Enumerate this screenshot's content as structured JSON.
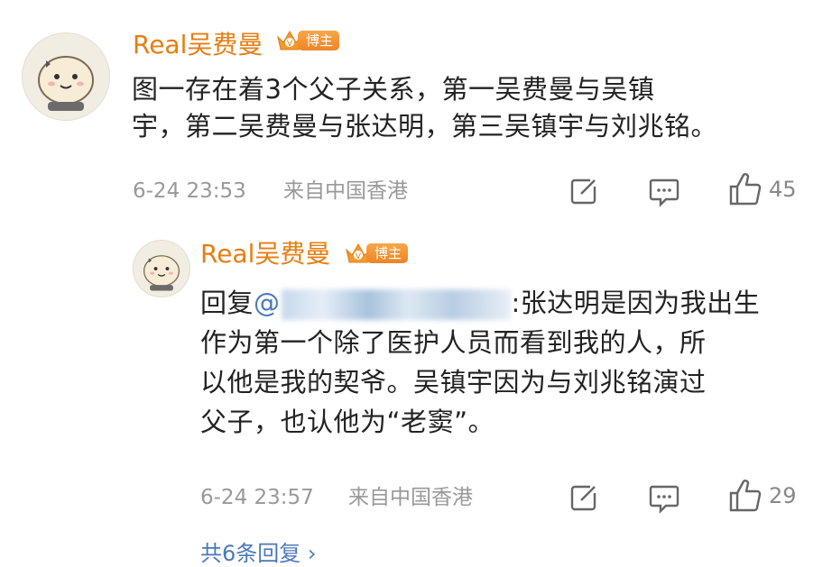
{
  "comment": {
    "username": "Real吴费曼",
    "badge_label": "博主",
    "text_line1": "图一存在着3个父子关系，第一吴费曼与吴镇",
    "text_line2": "宇，第二吴费曼与张达明，第三吴镇宇与刘兆铭。",
    "date": "6-24 23:53",
    "location": "来自中国香港",
    "like_count": "45"
  },
  "reply": {
    "username": "Real吴费曼",
    "badge_label": "博主",
    "reply_prefix": "回复",
    "mention_at": "@",
    "text_line1_after": ":张达明是因为我出生",
    "text_line2": "作为第一个除了医护人员而看到我的人，所",
    "text_line3": "以他是我的契爷。吴镇宇因为与刘兆铭演过",
    "text_line4": "父子，也认他为“老窦”。",
    "date": "6-24 23:57",
    "location": "来自中国香港",
    "like_count": "29"
  },
  "more_replies": "共6条回复 ›",
  "colors": {
    "username": "#e77d10",
    "badge": "#ee8525",
    "mention": "#4a79b8",
    "meta": "#999999"
  },
  "icons": [
    "avatar",
    "crown-icon",
    "share-icon",
    "comment-icon",
    "like-icon"
  ]
}
